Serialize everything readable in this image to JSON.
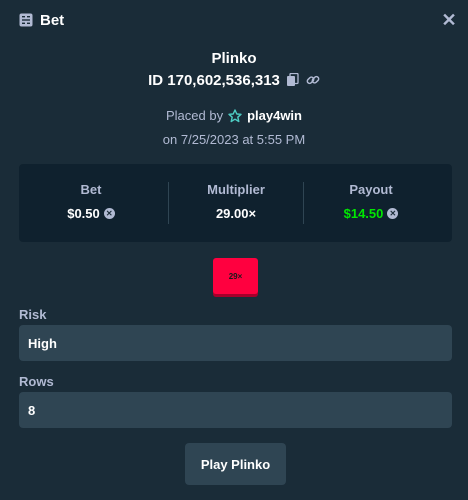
{
  "header": {
    "title": "Bet",
    "title_icon": "receipt-icon",
    "close_icon": "close-icon",
    "close_glyph": "✕"
  },
  "bet": {
    "game": "Plinko",
    "id": "ID 170,602,536,313",
    "placed_by_prefix": "Placed by",
    "username": "play4win",
    "date": "on 7/25/2023 at 5:55 PM"
  },
  "stats": {
    "bet_label": "Bet",
    "bet_value": "$0.50",
    "multiplier_label": "Multiplier",
    "multiplier_value": "29.00×",
    "payout_label": "Payout",
    "payout_value": "$14.50"
  },
  "chip": {
    "label": "29×"
  },
  "fields": {
    "risk_label": "Risk",
    "risk_value": "High",
    "rows_label": "Rows",
    "rows_value": "8"
  },
  "actions": {
    "play_label": "Play Plinko"
  },
  "colors": {
    "background": "#1a2c38",
    "panel": "#0f212e",
    "input": "#2f4553",
    "payout_green": "#00e701",
    "chip_red": "#ff003f",
    "muted_text": "#b1bad3"
  }
}
